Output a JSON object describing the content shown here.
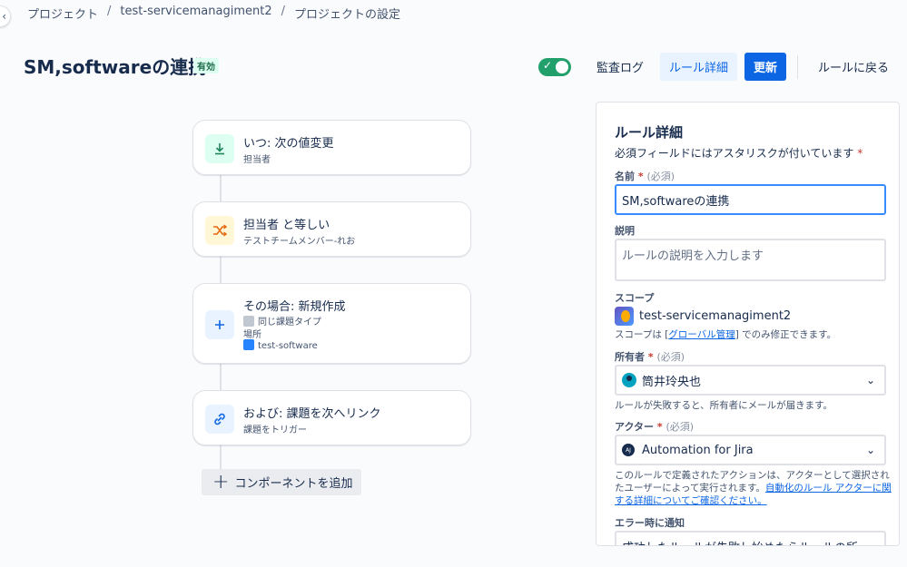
{
  "breadcrumb": [
    "プロジェクト",
    "test-servicemanagiment2",
    "プロジェクトの設定"
  ],
  "header": {
    "title": "SM,softwareの連携",
    "status": "有効",
    "toggle_on": true,
    "audit_log": "監査ログ",
    "rule_details": "ルール詳細",
    "update": "更新",
    "back": "ルールに戻る"
  },
  "flow": {
    "trigger": {
      "title": "いつ: 次の値変更",
      "subtitle": "担当者"
    },
    "condition": {
      "title": "担当者 と等しい",
      "subtitle": "テストチームメンバー-れお"
    },
    "action_create": {
      "title": "その場合: 新規作成",
      "line1": "同じ課題タイプ",
      "line2": "場所",
      "line3": "test-software"
    },
    "action_link": {
      "title": "および: 課題を次へリンク",
      "subtitle": "課題をトリガー"
    },
    "add_component": "コンポーネントを追加"
  },
  "panel": {
    "heading": "ルール詳細",
    "required_note": "必須フィールドにはアスタリスクが付いています",
    "name_label": "名前",
    "required_text": "(必須)",
    "name_value": "SM,softwareの連携",
    "desc_label": "説明",
    "desc_placeholder": "ルールの説明を入力します",
    "scope_label": "スコープ",
    "scope_value": "test-servicemanagiment2",
    "scope_help_pre": "スコープは [",
    "scope_help_link": "グローバル管理",
    "scope_help_post": "] でのみ修正できます。",
    "owner_label": "所有者",
    "owner_value": "筒井玲央也",
    "owner_help": "ルールが失敗すると、所有者にメールが届きます。",
    "actor_label": "アクター",
    "actor_avatar": "AJ",
    "actor_value": "Automation for Jira",
    "actor_help_1": "このルールで定義されたアクションは、アクターとして選択され",
    "actor_help_2a": "たユーザーによって実行されます。",
    "actor_help_2b": "自動化のルール アクターに関",
    "actor_help_3": "する詳細についてご確認ください。",
    "error_label": "エラー時に通知",
    "error_value": "成功したルールが失敗し始めたらルールの所..."
  },
  "colors": {
    "accent": "#0c66e4",
    "toggle": "#22a06b",
    "status_bg": "#dcfff1"
  }
}
